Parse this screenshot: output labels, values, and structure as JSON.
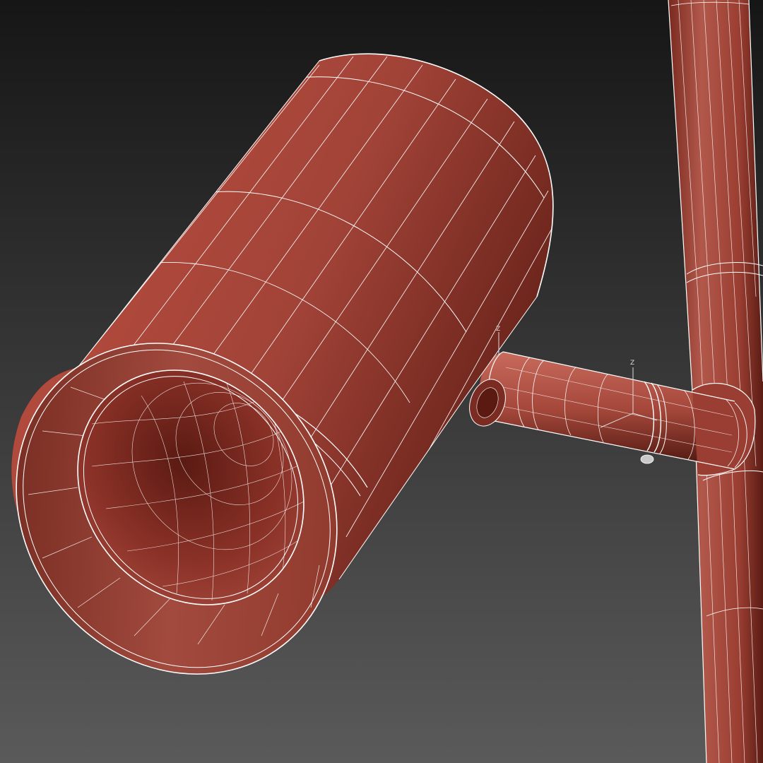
{
  "viewport": {
    "background_top": "#161616",
    "background_bottom": "#5a5a5a",
    "model_color": "#a8473a",
    "model_color_dark": "#5e1e15",
    "wire_color": "#ffffff"
  },
  "gizmos": [
    {
      "axis_label": "Z"
    },
    {
      "axis_label": "Z"
    }
  ]
}
